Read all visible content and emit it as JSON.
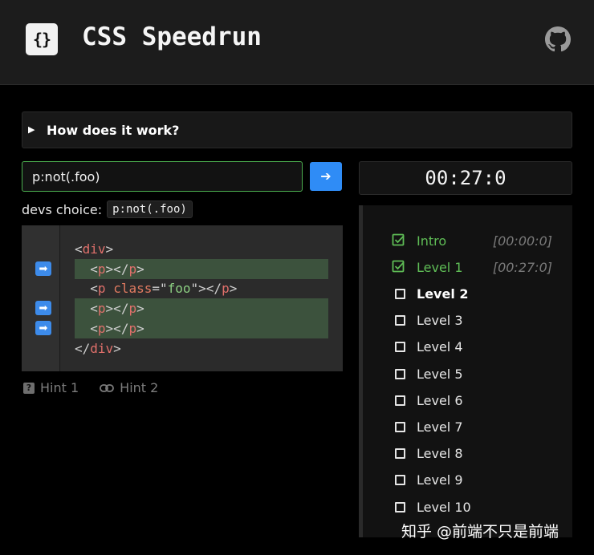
{
  "header": {
    "logo_text": "{}",
    "title": "CSS Speedrun",
    "github_icon": "github-icon"
  },
  "how": {
    "label": "How does it work?"
  },
  "selector": {
    "value": "p:not(.foo)",
    "submit_icon": "arrow-right-icon",
    "accent": "#2f8cf6"
  },
  "devs_choice": {
    "label": "devs choice:",
    "code": "p:not(.foo)"
  },
  "code": {
    "lines": [
      {
        "indent": "",
        "tag_open": "div",
        "attr": "",
        "value": "",
        "close": "",
        "highlighted": false,
        "marked": false
      },
      {
        "indent": "  ",
        "tag_open": "p",
        "attr": "",
        "value": "",
        "close": "p",
        "highlighted": true,
        "marked": true
      },
      {
        "indent": "  ",
        "tag_open": "p",
        "attr": "class",
        "value": "foo",
        "close": "p",
        "highlighted": false,
        "marked": false
      },
      {
        "indent": "  ",
        "tag_open": "p",
        "attr": "",
        "value": "",
        "close": "p",
        "highlighted": true,
        "marked": true
      },
      {
        "indent": "  ",
        "tag_open": "p",
        "attr": "",
        "value": "",
        "close": "p",
        "highlighted": true,
        "marked": true
      },
      {
        "indent": "",
        "tag_end": "div"
      }
    ]
  },
  "hints": [
    {
      "label": "Hint 1",
      "icon": "question-icon"
    },
    {
      "label": "Hint 2",
      "icon": "link-icon"
    }
  ],
  "timer": "00:27:0",
  "levels": [
    {
      "label": "Intro",
      "time": "[00:00:0]",
      "status": "done"
    },
    {
      "label": "Level 1",
      "time": "[00:27:0]",
      "status": "done"
    },
    {
      "label": "Level 2",
      "time": "",
      "status": "current"
    },
    {
      "label": "Level 3",
      "time": "",
      "status": "todo"
    },
    {
      "label": "Level 4",
      "time": "",
      "status": "todo"
    },
    {
      "label": "Level 5",
      "time": "",
      "status": "todo"
    },
    {
      "label": "Level 6",
      "time": "",
      "status": "todo"
    },
    {
      "label": "Level 7",
      "time": "",
      "status": "todo"
    },
    {
      "label": "Level 8",
      "time": "",
      "status": "todo"
    },
    {
      "label": "Level 9",
      "time": "",
      "status": "todo"
    },
    {
      "label": "Level 10",
      "time": "",
      "status": "todo"
    }
  ],
  "colors": {
    "done": "#5fbd56",
    "highlight": "#3c523d",
    "tag": "#e0706b",
    "string": "#8ccf82"
  },
  "watermark": "知乎 @前端不只是前端"
}
